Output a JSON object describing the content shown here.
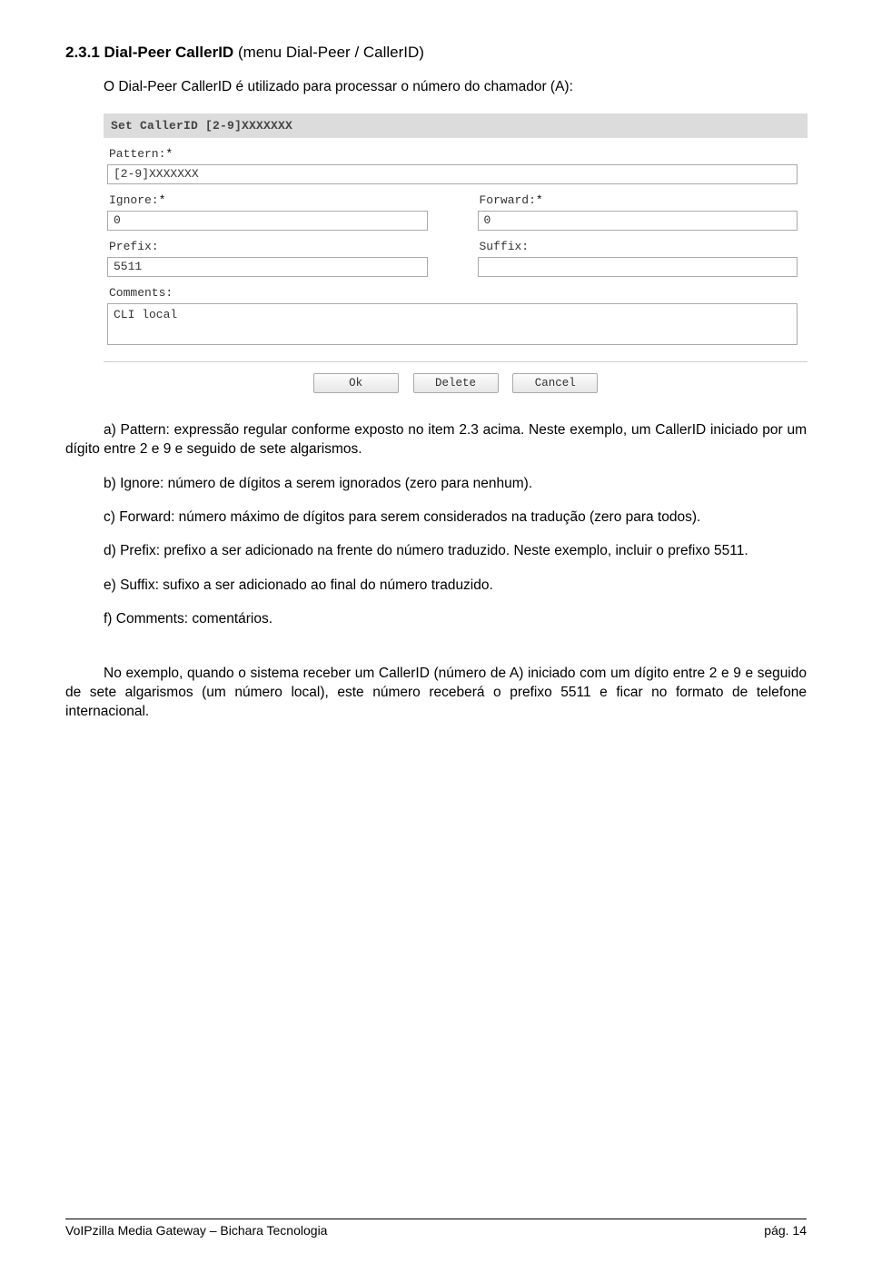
{
  "heading": {
    "num": "2.3.1 Dial-Peer CallerID",
    "paren": "(menu Dial-Peer / CallerID)"
  },
  "intro": "O Dial-Peer CallerID é utilizado para processar o número do chamador (A):",
  "screenshot": {
    "title": "Set CallerID [2-9]XXXXXXX",
    "labels": {
      "pattern": "Pattern:",
      "ignore": "Ignore:",
      "forward": "Forward:",
      "prefix": "Prefix:",
      "suffix": "Suffix:",
      "comments": "Comments:"
    },
    "req": "*",
    "values": {
      "pattern": "[2-9]XXXXXXX",
      "ignore": "0",
      "forward": "0",
      "prefix": "5511",
      "suffix": "",
      "comments": "CLI local"
    },
    "buttons": {
      "ok": "Ok",
      "delete": "Delete",
      "cancel": "Cancel"
    }
  },
  "paras": {
    "a": "a) Pattern: expressão regular conforme exposto no item 2.3 acima. Neste exemplo, um CallerID iniciado por um dígito entre 2 e 9 e seguido de sete algarismos.",
    "b": "b) Ignore: número de dígitos a serem ignorados (zero para nenhum).",
    "c": "c) Forward: número máximo de dígitos para serem considerados na tradução (zero para todos).",
    "d": "d) Prefix: prefixo a ser adicionado na frente do número traduzido. Neste exemplo, incluir o prefixo 5511.",
    "e": "e) Suffix: sufixo a ser adicionado ao final do número traduzido.",
    "f": "f) Comments: comentários.",
    "example": "No exemplo, quando o sistema receber um CallerID (número de A) iniciado com um dígito entre 2 e 9 e seguido de sete algarismos (um número local), este número receberá o prefixo 5511 e ficar no formato de telefone internacional."
  },
  "footer": {
    "left": "VoIPzilla Media Gateway – Bichara Tecnologia",
    "right": "pág. 14"
  }
}
